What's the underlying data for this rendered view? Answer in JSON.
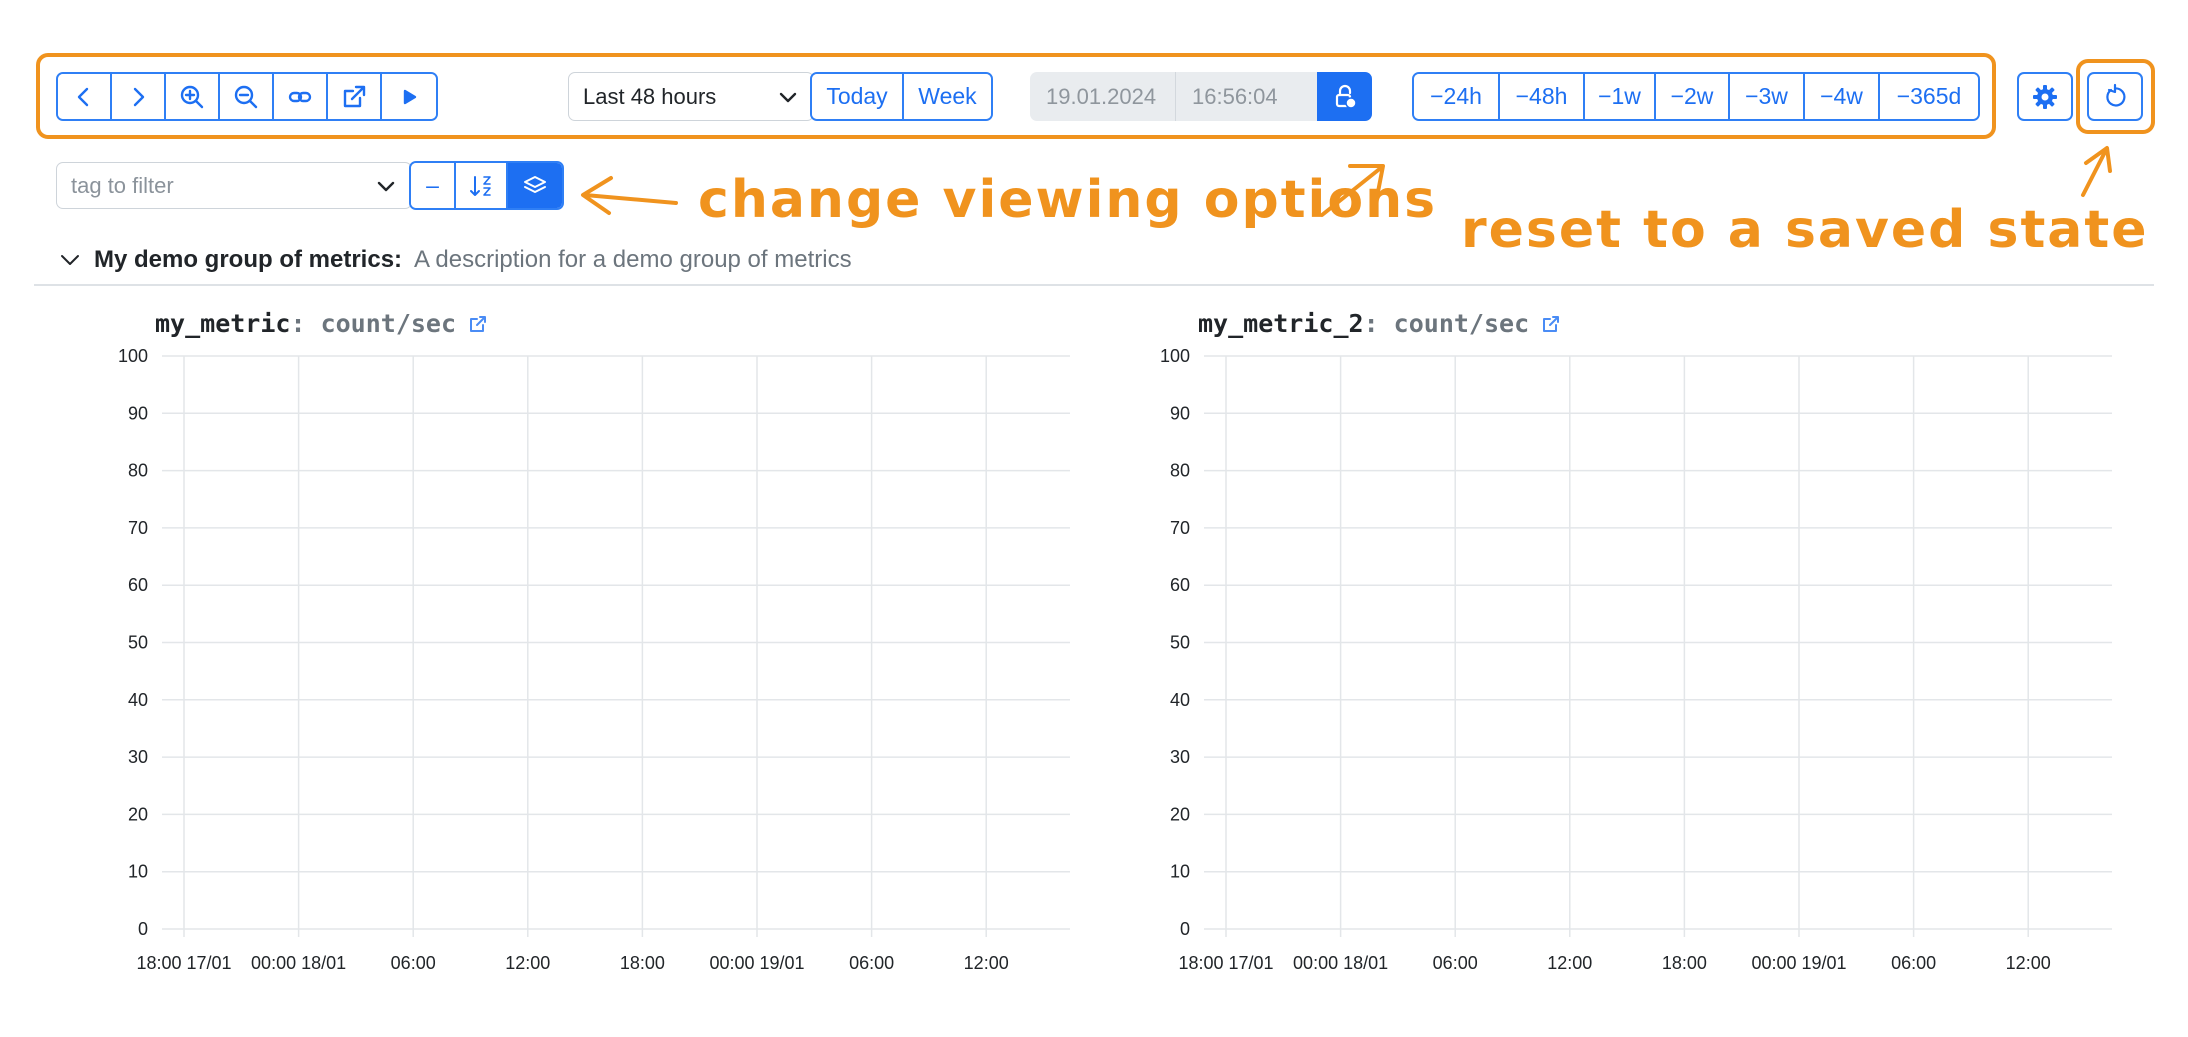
{
  "toolbar": {
    "nav_buttons": [
      {
        "name": "back-button",
        "icon": "chevron-left-icon"
      },
      {
        "name": "forward-button",
        "icon": "chevron-right-icon"
      },
      {
        "name": "zoom-in-button",
        "icon": "zoom-in-icon"
      },
      {
        "name": "zoom-out-button",
        "icon": "zoom-out-icon"
      },
      {
        "name": "link-button",
        "icon": "link-icon"
      },
      {
        "name": "open-external-button",
        "icon": "external-link-icon"
      },
      {
        "name": "play-button",
        "icon": "play-icon"
      }
    ],
    "range_select": {
      "value": "Last 48 hours"
    },
    "today_label": "Today",
    "week_label": "Week",
    "date_value": "19.01.2024",
    "time_value": "16:56:04",
    "lock_icon": "lock-clock-icon",
    "shift_buttons": [
      "−24h",
      "−48h",
      "−1w",
      "−2w",
      "−3w",
      "−4w",
      "−365d"
    ],
    "settings_icon": "gear-icon",
    "reset_icon": "reset-icon"
  },
  "filter": {
    "placeholder": "tag to filter",
    "minus_label": "–",
    "sort_icon": "sort-icon",
    "layers_icon": "layers-icon"
  },
  "annotations": {
    "viewing_options": "change viewing options",
    "reset_state": "reset to a saved state",
    "color": "#f0931e"
  },
  "group": {
    "title": "My demo group of metrics:",
    "description": "A description for a demo group of metrics"
  },
  "charts": [
    {
      "name": "my_metric",
      "unit": ": count/sec"
    },
    {
      "name": "my_metric_2",
      "unit": ": count/sec"
    }
  ],
  "chart_data": [
    {
      "type": "line",
      "title": "my_metric",
      "ylim": [
        0,
        100
      ],
      "yticks": [
        0,
        10,
        20,
        30,
        40,
        50,
        60,
        70,
        80,
        90,
        100
      ],
      "xticks": [
        "18:00 17/01",
        "00:00 18/01",
        "06:00",
        "12:00",
        "18:00",
        "00:00 19/01",
        "06:00",
        "12:00"
      ],
      "series": [],
      "grid": true
    },
    {
      "type": "line",
      "title": "my_metric_2",
      "ylim": [
        0,
        100
      ],
      "yticks": [
        0,
        10,
        20,
        30,
        40,
        50,
        60,
        70,
        80,
        90,
        100
      ],
      "xticks": [
        "18:00 17/01",
        "00:00 18/01",
        "06:00",
        "12:00",
        "18:00",
        "00:00 19/01",
        "06:00",
        "12:00"
      ],
      "series": [],
      "grid": true
    }
  ]
}
